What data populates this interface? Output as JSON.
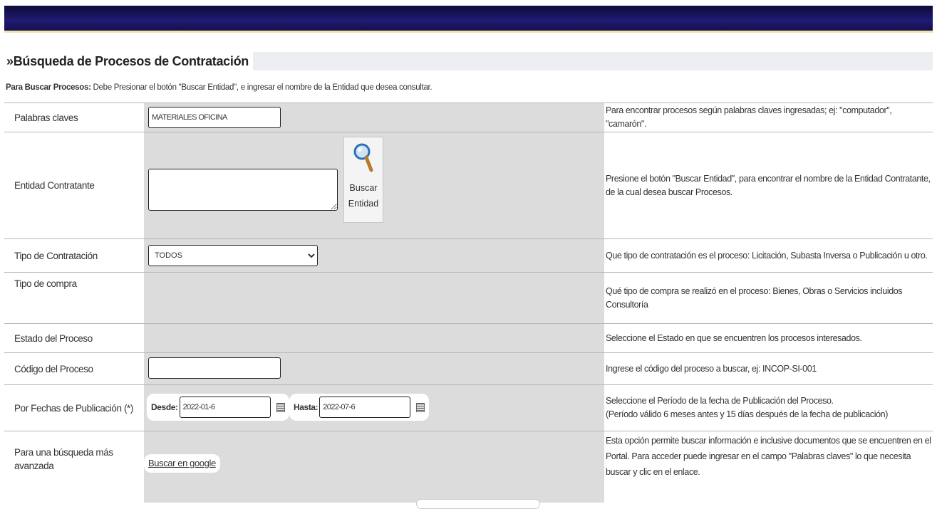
{
  "header": {
    "title": "»Búsqueda de Procesos de Contratación",
    "intro_bold": "Para Buscar Procesos:",
    "intro_text": " Debe Presionar el botón \"Buscar Entidad\", e ingresar el nombre de la Entidad que desea consultar."
  },
  "rows": {
    "keywords": {
      "label": "Palabras claves",
      "value": "MATERIALES OFICINA",
      "help": "Para encontrar procesos según palabras claves ingresadas; ej: \"computador\", \"camarón\"."
    },
    "entity": {
      "label": "Entidad Contratante",
      "value": "",
      "button_line1": "Buscar",
      "button_line2": "Entidad",
      "help": "Presione el botón \"Buscar Entidad\", para encontrar el nombre de la Entidad Contratante, de la cual desea buscar Procesos."
    },
    "contract_type": {
      "label": "Tipo de Contratación",
      "selected": "TODOS",
      "help": "Que tipo de contratación es el proceso: Licitación, Subasta Inversa o Publicación u otro."
    },
    "purchase_type": {
      "label": "Tipo de compra",
      "help": "Qué tipo de compra se realizó en el proceso: Bienes, Obras o Servicios incluidos Consultoría"
    },
    "process_state": {
      "label": "Estado del Proceso",
      "help": "Seleccione el Estado en que se encuentren los procesos interesados."
    },
    "process_code": {
      "label": "Código del Proceso",
      "value": "",
      "help": "Ingrese el código del proceso a buscar, ej: INCOP-SI-001"
    },
    "dates": {
      "label": "Por Fechas de Publicación (*)",
      "from_label": "Desde:",
      "from_value": "2022-01-6",
      "to_label": "Hasta:",
      "to_value": "2022-07-6",
      "help_line1": "Seleccione el Período de la fecha de Publicación del Proceso.",
      "help_line2": "(Período válido 6 meses antes y 15 días después de la fecha de publicación)"
    },
    "advanced": {
      "label": "Para una búsqueda más avanzada",
      "link": "Buscar en google",
      "help": "Esta opción permite buscar información e inclusive documentos que se encuentren en el Portal. Para acceder puede ingresar en el campo \"Palabras claves\" lo que necesita buscar y clic en el enlace."
    }
  },
  "icons": {
    "search_button_icon": "magnifier-icon",
    "calendar": "calendar-icon"
  }
}
